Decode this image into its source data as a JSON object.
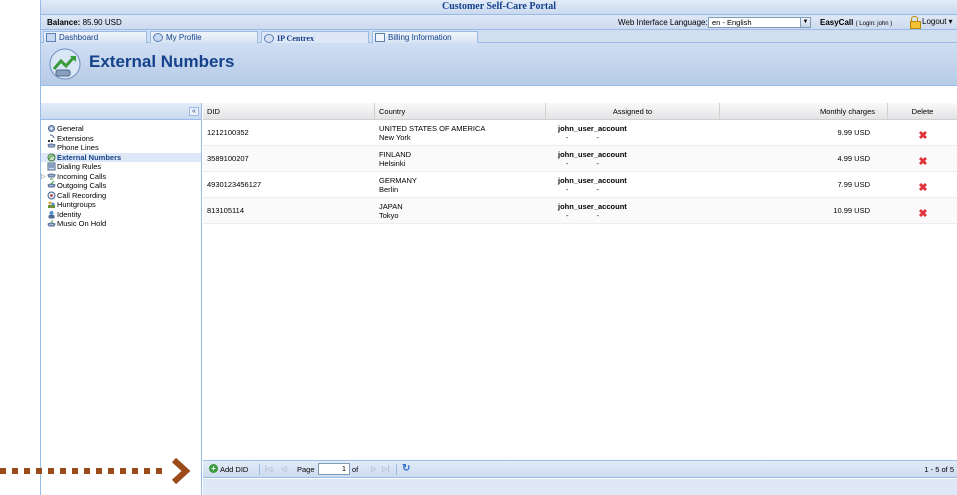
{
  "window_title": "Customer Self-Care Portal",
  "status": {
    "balance_label": "Balance:",
    "balance_value": "85.90 USD",
    "language_label": "Web Interface Language:",
    "language_value": "en - English",
    "account_name": "EasyCall",
    "login_text": "( Login: john )",
    "logout_label": "Logout"
  },
  "tabs": [
    {
      "label": "Dashboard",
      "icon": "dashboard-icon"
    },
    {
      "label": "My Profile",
      "icon": "profile-icon"
    },
    {
      "label": "IP Centrex",
      "icon": "gear-icon",
      "active": true
    },
    {
      "label": "Billing Information",
      "icon": "billing-icon"
    }
  ],
  "hero": {
    "title": "External Numbers"
  },
  "sidebar": {
    "items": [
      {
        "label": "General",
        "icon": "gear-icon"
      },
      {
        "label": "Extensions",
        "icon": "extensions-icon"
      },
      {
        "label": "Phone Lines",
        "icon": "phone-icon"
      },
      {
        "label": "External Numbers",
        "icon": "external-numbers-icon",
        "selected": true
      },
      {
        "label": "Dialing Rules",
        "icon": "dialing-rules-icon"
      },
      {
        "label": "Incoming Calls",
        "icon": "incoming-calls-icon",
        "expandable": true
      },
      {
        "label": "Outgoing Calls",
        "icon": "outgoing-calls-icon"
      },
      {
        "label": "Call Recording",
        "icon": "call-recording-icon"
      },
      {
        "label": "Huntgroups",
        "icon": "huntgroups-icon"
      },
      {
        "label": "Identity",
        "icon": "identity-icon"
      },
      {
        "label": "Music On Hold",
        "icon": "music-on-hold-icon"
      }
    ]
  },
  "grid": {
    "columns": [
      "DID",
      "Country",
      "Assigned to",
      "Monthly charges",
      "Delete"
    ],
    "rows": [
      {
        "did": "1212100352",
        "country": "UNITED STATES OF AMERICA",
        "city": "New York",
        "assigned": "john_user_account",
        "dash1": "-",
        "dash2": "-",
        "charges": "9.99 USD"
      },
      {
        "did": "3589100207",
        "country": "FINLAND",
        "city": "Helsinki",
        "assigned": "john_user_account",
        "dash1": "-",
        "dash2": "-",
        "charges": "4.99 USD"
      },
      {
        "did": "4930123456127",
        "country": "GERMANY",
        "city": "Berlin",
        "assigned": "john_user_account",
        "dash1": "-",
        "dash2": "-",
        "charges": "7.99 USD"
      },
      {
        "did": "813105114",
        "country": "JAPAN",
        "city": "Tokyo",
        "assigned": "john_user_account",
        "dash1": "-",
        "dash2": "-",
        "charges": "10.99 USD"
      }
    ]
  },
  "pager": {
    "add_label": "Add DID",
    "page_label": "Page",
    "page_value": "1",
    "of_label": "of",
    "count_text": "1 - 5 of 5"
  },
  "colors": {
    "accent": "#15428b",
    "border": "#99bbe8",
    "delete": "#e0333a",
    "callout": "#9b4a1a"
  }
}
